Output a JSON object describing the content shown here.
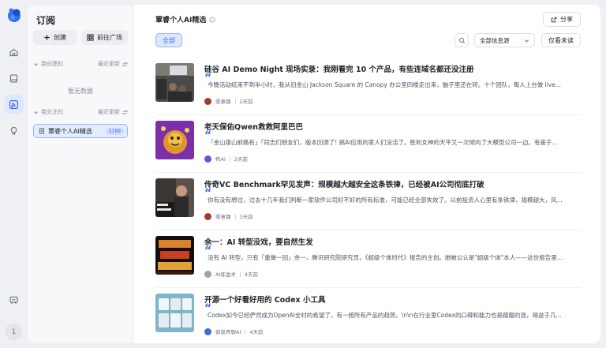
{
  "sidebar": {
    "title": "订阅",
    "create_label": "创建",
    "plaza_label": "前往广场",
    "created_section": {
      "label": "我创建的",
      "sort_label": "最近更新",
      "empty_text": "暂无数据"
    },
    "followed_section": {
      "label": "我关注的",
      "sort_label": "最近更新"
    },
    "followed_items": [
      {
        "label": "覃睿个人AI精选",
        "count": "1189"
      }
    ]
  },
  "rail": {
    "avatar_text": "1"
  },
  "header": {
    "title": "覃睿个人AI精选",
    "share_label": "分享"
  },
  "filters": {
    "all_label": "全部",
    "source_select_value": "全部信息源",
    "unread_label": "仅看未读"
  },
  "articles": [
    {
      "title": "硅谷 AI Demo Night 现场实录：我刚看完 10 个产品，有些连域名都还没注册",
      "snippet": "今晚活动结束不到半小时，我从旧金山 Jackson Square 的 Canopy 办公室四楼走出来，脑子里还在转。十个团队，每人上台做 live...",
      "source": "渠意璐",
      "time": "2天前",
      "thumb": "photo-room"
    },
    {
      "title": "老天保佑Qwen救救阿里巴巴",
      "snippet": "「金山银山前路有」「同志们朋友们，版本回调了! 搞AI应用的家人们没活了。胜利女神的天平又一次倾向了大模型公司一边。有鉴于...",
      "source": "鸭AI",
      "time": "2天前",
      "thumb": "cartoon"
    },
    {
      "title": "传奇VC Benchmark罕见发声：规模越大越安全这条铁律，已经被AI公司彻底打破",
      "snippet": "你有没有想过，过去十几年我们判断一家软件公司好不好的所有标准，可能已经全部失效了。以前投资人心里有条铁律，规模越大，风...",
      "source": "渠意璐",
      "time": "3天前",
      "thumb": "speaker"
    },
    {
      "title": "余一：AI 转型没戏，要自然生发",
      "snippet": "没有 AI 转型，只有「重做一回」余一，腾讯研究院研究员，《超级个体时代》报告的主创。她被公认是\"超级个体\"本人——这份报告里...",
      "source": "AI炼金术",
      "time": "4天前",
      "thumb": "poster"
    },
    {
      "title": "开源一个好看好用的 Codex 小工具",
      "snippet": "Codex如今已经俨然成为OpenAI全村的希望了，有一统所有产品的趋势。\\n\\n在行业里Codex的口碑和能力也是蹭蹭的涨，得益于几...",
      "source": "郭嵩焘聊AI",
      "time": "4天前",
      "thumb": "app-screens"
    }
  ],
  "colors": {
    "accent": "#3f6ee8",
    "accent_bg": "#dbe6ff",
    "text": "#1f2329"
  },
  "icons": [
    "app-logo",
    "home-icon",
    "library-icon",
    "rss-icon",
    "bulb-icon",
    "feedback-icon",
    "plus-icon",
    "grid-icon",
    "info-icon",
    "share-icon",
    "search-icon",
    "chevron-down-icon",
    "sort-icon",
    "doc-icon"
  ]
}
